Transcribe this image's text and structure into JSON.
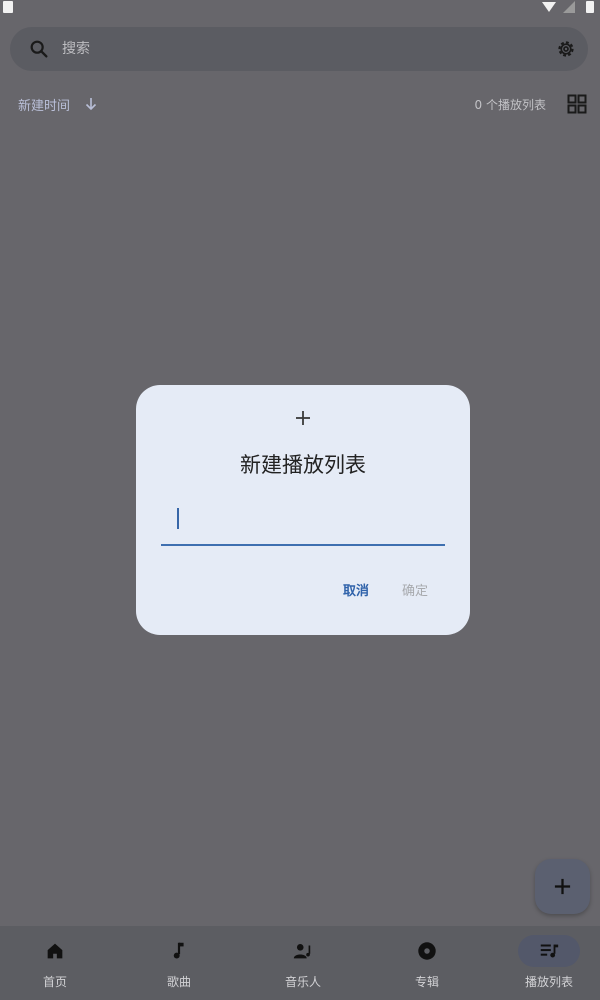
{
  "search": {
    "placeholder": "搜索"
  },
  "sort": {
    "label": "新建时间"
  },
  "playlist_count": "0 个播放列表",
  "dialog": {
    "title": "新建播放列表",
    "input_value": "",
    "cancel_label": "取消",
    "confirm_label": "确定"
  },
  "bottom_nav": {
    "items": [
      {
        "label": "首页",
        "icon": "home-icon"
      },
      {
        "label": "歌曲",
        "icon": "music-note-icon"
      },
      {
        "label": "音乐人",
        "icon": "artist-icon"
      },
      {
        "label": "专辑",
        "icon": "album-icon"
      },
      {
        "label": "播放列表",
        "icon": "playlist-icon",
        "selected": true
      }
    ]
  },
  "colors": {
    "accent": "#2f62aa",
    "dialog_bg": "#e5ebf6",
    "scrim": "#67666b"
  }
}
